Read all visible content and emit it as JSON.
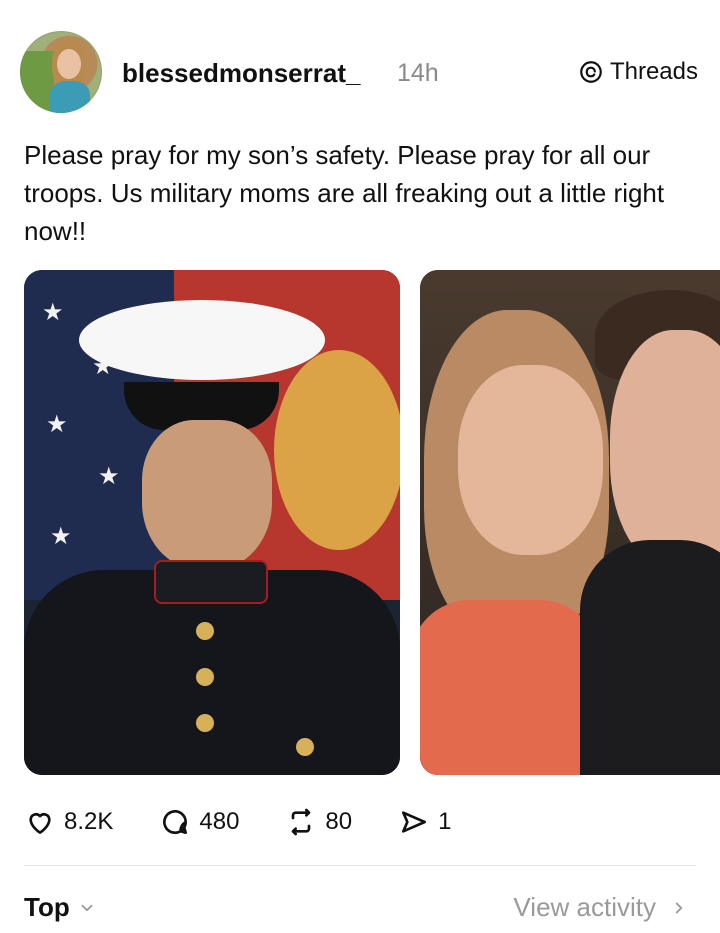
{
  "post": {
    "username": "blessedmonserrat_",
    "time": "14h",
    "platform": "Threads",
    "text": "Please pray for my son’s safety. Please pray for all our troops. Us military moms are all freaking out a little right now!!",
    "stats": {
      "likes": "8.2K",
      "comments": "480",
      "reposts": "80",
      "shares": "1"
    }
  },
  "footer": {
    "sort": "Top",
    "activity": "View activity"
  },
  "icons": {
    "threads": "threads-logo-icon",
    "like": "heart-icon",
    "comment": "comment-icon",
    "repost": "repost-icon",
    "share": "send-icon",
    "chevron_down": "chevron-down-icon",
    "chevron_right": "chevron-right-icon"
  }
}
